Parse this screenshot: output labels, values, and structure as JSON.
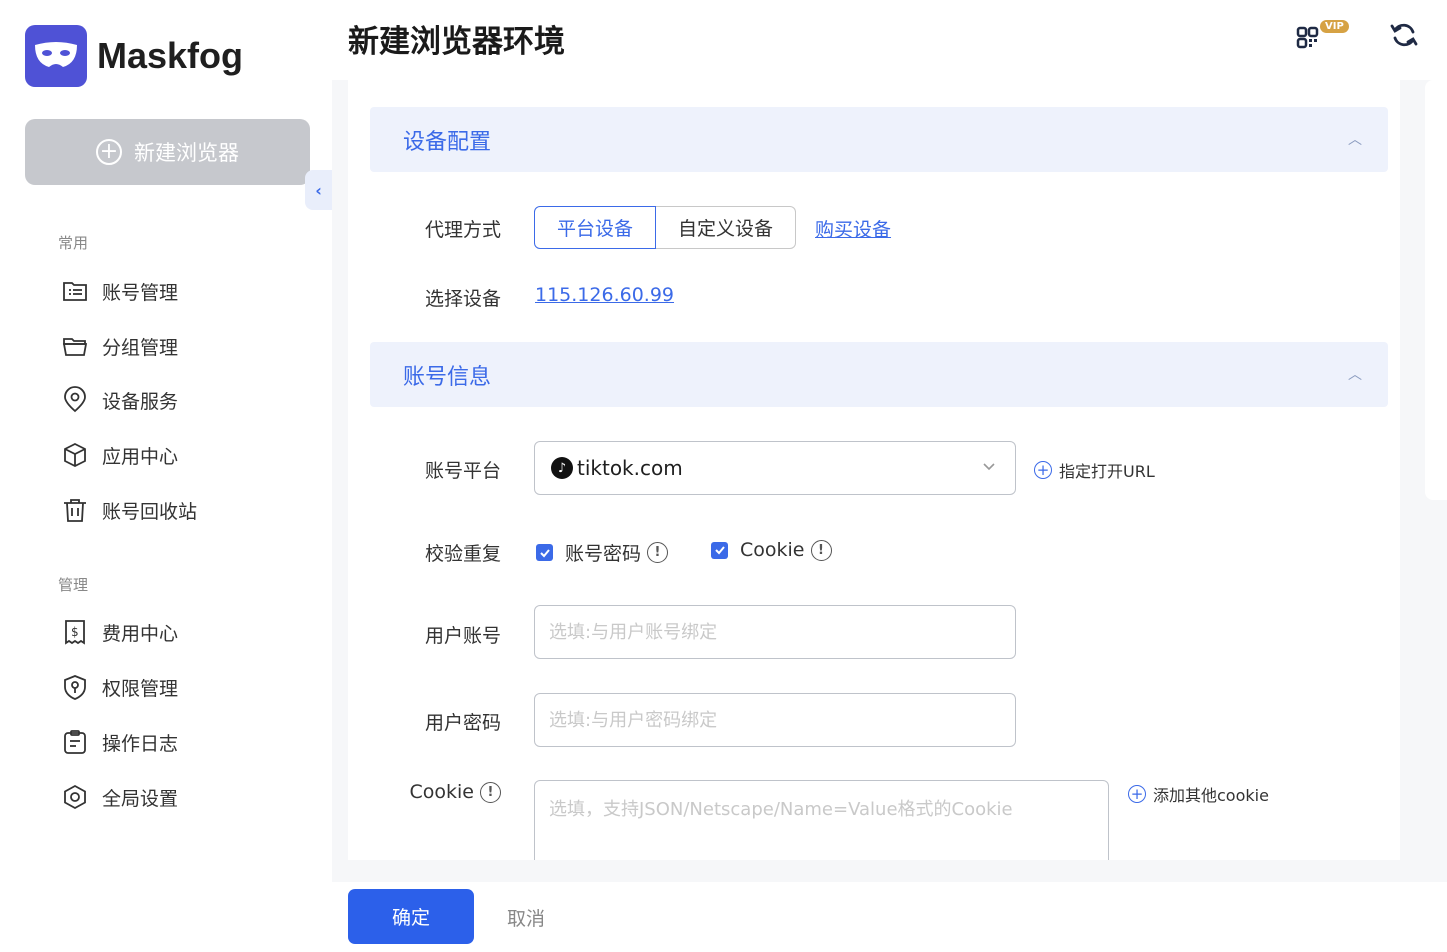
{
  "brand": {
    "name": "Maskfog"
  },
  "sidebar": {
    "new_browser_label": "新建浏览器",
    "sections": [
      {
        "label": "常用"
      },
      {
        "label": "管理"
      }
    ],
    "items": [
      {
        "label": "账号管理",
        "icon": "account-list-icon"
      },
      {
        "label": "分组管理",
        "icon": "folder-icon"
      },
      {
        "label": "设备服务",
        "icon": "location-pin-icon"
      },
      {
        "label": "应用中心",
        "icon": "cube-icon"
      },
      {
        "label": "账号回收站",
        "icon": "trash-icon"
      },
      {
        "label": "费用中心",
        "icon": "dollar-doc-icon"
      },
      {
        "label": "权限管理",
        "icon": "shield-key-icon"
      },
      {
        "label": "操作日志",
        "icon": "clipboard-icon"
      },
      {
        "label": "全局设置",
        "icon": "settings-hex-icon"
      }
    ]
  },
  "header": {
    "title": "新建浏览器环境",
    "vip_badge": "VIP"
  },
  "device_section": {
    "title": "设备配置",
    "proxy_label": "代理方式",
    "proxy_options": [
      "平台设备",
      "自定义设备"
    ],
    "proxy_selected": "平台设备",
    "buy_link": "购买设备",
    "select_device_label": "选择设备",
    "device_ip": "115.126.60.99"
  },
  "account_section": {
    "title": "账号信息",
    "platform_label": "账号平台",
    "platform_value": "tiktok.com",
    "specify_url_label": "指定打开URL",
    "dedupe_label": "校验重复",
    "dedupe_options": [
      {
        "label": "账号密码",
        "checked": true
      },
      {
        "label": "Cookie",
        "checked": true
      }
    ],
    "user_account_label": "用户账号",
    "user_account_placeholder": "选填:与用户账号绑定",
    "user_password_label": "用户密码",
    "user_password_placeholder": "选填:与用户密码绑定",
    "cookie_label": "Cookie",
    "cookie_placeholder": "选填，支持JSON/Netscape/Name=Value格式的Cookie",
    "add_cookie_label": "添加其他cookie"
  },
  "footer": {
    "confirm_label": "确定",
    "cancel_label": "取消"
  },
  "colors": {
    "accent": "#2c60ea",
    "section_bg": "#eef2fc",
    "logo_bg": "#4f52d6"
  }
}
